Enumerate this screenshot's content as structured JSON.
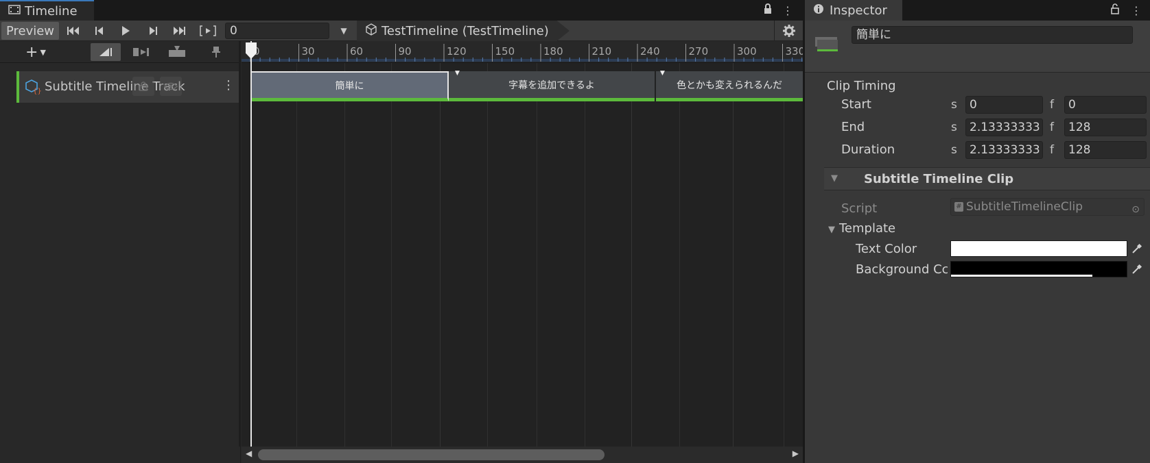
{
  "timeline": {
    "tab_title": "Timeline",
    "preview_label": "Preview",
    "frame_value": "0",
    "breadcrumb": "TestTimeline (TestTimeline)",
    "ruler_ticks": [
      "0",
      "30",
      "60",
      "90",
      "120",
      "150",
      "180",
      "210",
      "240",
      "270",
      "300",
      "330"
    ],
    "track": {
      "label": "Subtitle Timeline Track",
      "accent_color": "#5cba3c"
    },
    "clips": [
      {
        "label": "簡単に",
        "selected": true
      },
      {
        "label": "字幕を追加できるよ",
        "selected": false
      },
      {
        "label": "色とかも変えられるんだ",
        "selected": false
      }
    ]
  },
  "inspector": {
    "tab_title": "Inspector",
    "object_name": "簡単に",
    "clip_timing": {
      "title": "Clip Timing",
      "rows": [
        {
          "label": "Start",
          "s_unit": "s",
          "s_value": "0",
          "f_unit": "f",
          "f_value": "0"
        },
        {
          "label": "End",
          "s_unit": "s",
          "s_value": "2.13333333",
          "f_unit": "f",
          "f_value": "128"
        },
        {
          "label": "Duration",
          "s_unit": "s",
          "s_value": "2.13333333",
          "f_unit": "f",
          "f_value": "128"
        }
      ]
    },
    "component": {
      "title": "Subtitle Timeline Clip",
      "script_label": "Script",
      "script_value": "SubtitleTimelineClip",
      "template_label": "Template",
      "text_color_label": "Text Color",
      "text_color": "#ffffff",
      "background_color_label": "Background Cc",
      "background_color": "#000000"
    }
  },
  "icons": [
    "film-icon",
    "lock-icon",
    "kebab-menu-icon",
    "go-to-start-icon",
    "previous-frame-icon",
    "play-icon",
    "next-frame-icon",
    "go-to-end-icon",
    "play-range-icon",
    "timeline-asset-icon",
    "gear-icon",
    "add-icon",
    "mix-mode-icon",
    "ripple-mode-icon",
    "replace-mode-icon",
    "pin-icon",
    "track-script-icon",
    "eye-icon",
    "info-icon",
    "eyedropper-icon",
    "target-icon"
  ]
}
